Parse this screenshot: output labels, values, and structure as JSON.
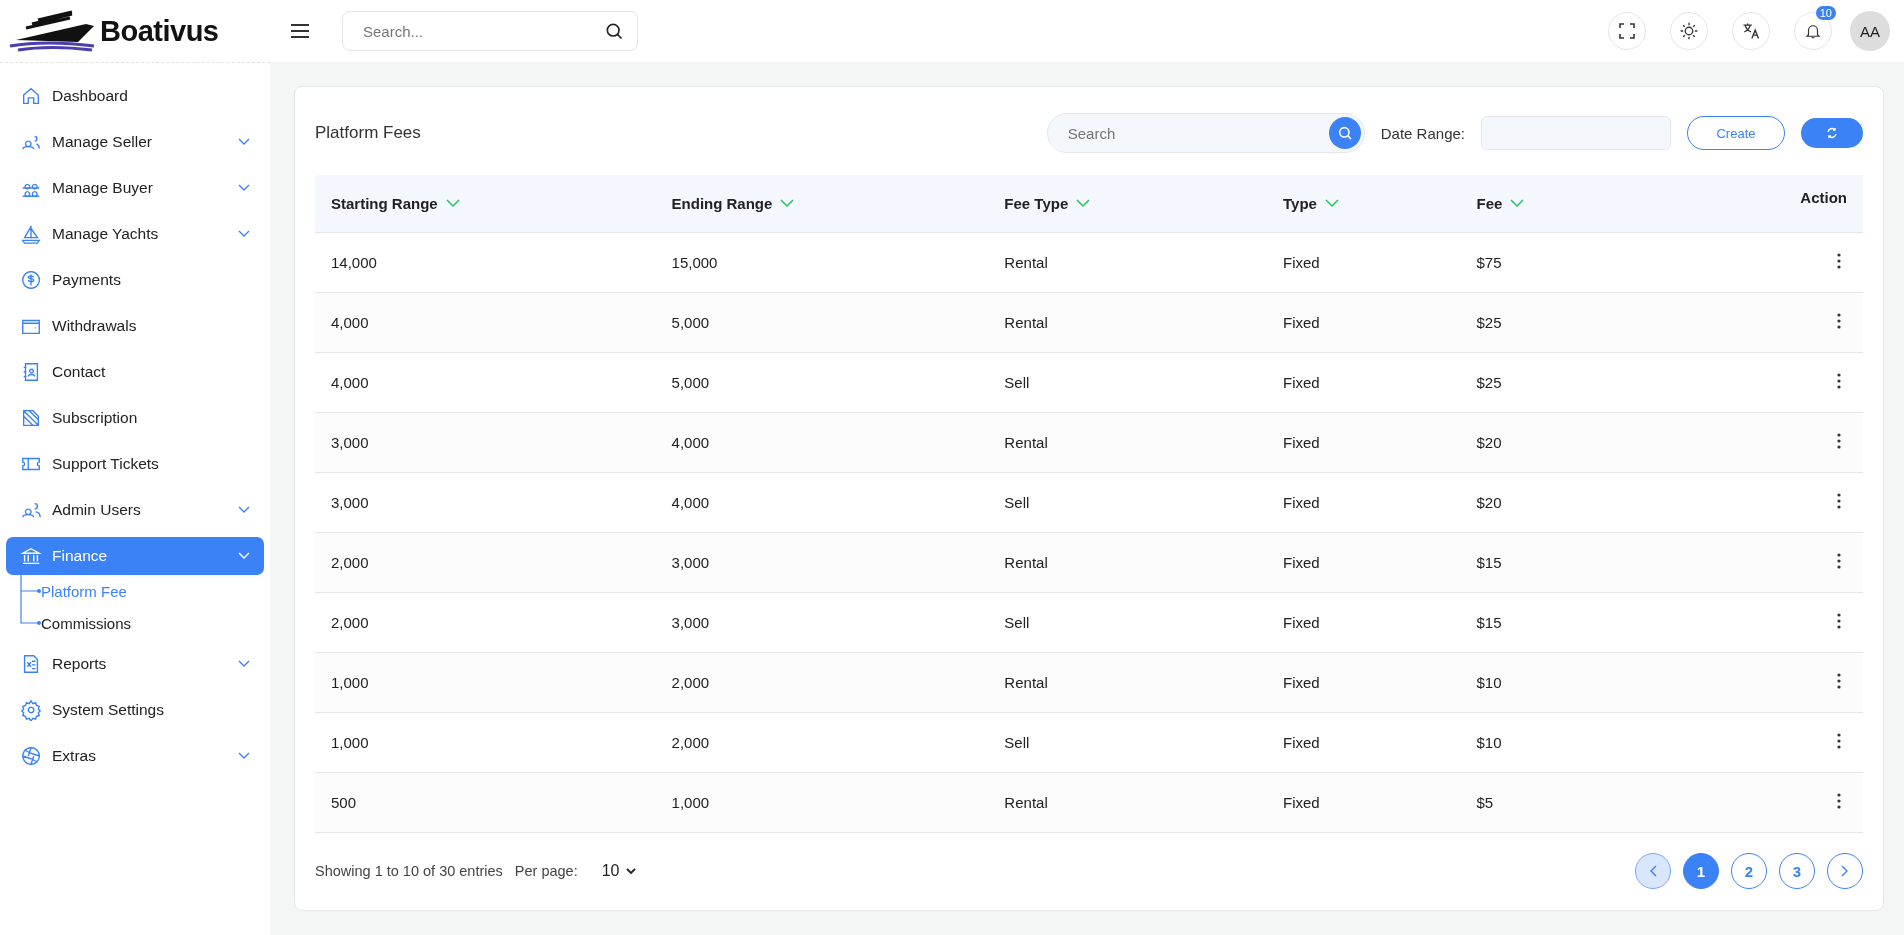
{
  "brand": {
    "name": "Boativus"
  },
  "topbar": {
    "search_placeholder": "Search...",
    "notification_count": "10",
    "avatar_initials": "AA"
  },
  "sidebar": {
    "items": [
      {
        "label": "Dashboard",
        "expandable": false,
        "selected": false
      },
      {
        "label": "Manage Seller",
        "expandable": true,
        "selected": false
      },
      {
        "label": "Manage Buyer",
        "expandable": true,
        "selected": false
      },
      {
        "label": "Manage Yachts",
        "expandable": true,
        "selected": false
      },
      {
        "label": "Payments",
        "expandable": false,
        "selected": false
      },
      {
        "label": "Withdrawals",
        "expandable": false,
        "selected": false
      },
      {
        "label": "Contact",
        "expandable": false,
        "selected": false
      },
      {
        "label": "Subscription",
        "expandable": false,
        "selected": false
      },
      {
        "label": "Support Tickets",
        "expandable": false,
        "selected": false
      },
      {
        "label": "Admin Users",
        "expandable": true,
        "selected": false
      },
      {
        "label": "Finance",
        "expandable": true,
        "selected": true,
        "children": [
          {
            "label": "Platform Fee",
            "selected": true
          },
          {
            "label": "Commissions",
            "selected": false
          }
        ]
      },
      {
        "label": "Reports",
        "expandable": true,
        "selected": false
      },
      {
        "label": "System Settings",
        "expandable": false,
        "selected": false
      },
      {
        "label": "Extras",
        "expandable": true,
        "selected": false
      }
    ]
  },
  "panel": {
    "title": "Platform Fees",
    "search_placeholder": "Search",
    "date_range_label": "Date Range:",
    "create_button": "Create"
  },
  "table": {
    "columns": [
      {
        "label": "Starting Range",
        "sortable": true
      },
      {
        "label": "Ending Range",
        "sortable": true
      },
      {
        "label": "Fee Type",
        "sortable": true
      },
      {
        "label": "Type",
        "sortable": true
      },
      {
        "label": "Fee",
        "sortable": true
      },
      {
        "label": "Action",
        "sortable": false
      }
    ],
    "rows": [
      [
        "14,000",
        "15,000",
        "Rental",
        "Fixed",
        "$75"
      ],
      [
        "4,000",
        "5,000",
        "Rental",
        "Fixed",
        "$25"
      ],
      [
        "4,000",
        "5,000",
        "Sell",
        "Fixed",
        "$25"
      ],
      [
        "3,000",
        "4,000",
        "Rental",
        "Fixed",
        "$20"
      ],
      [
        "3,000",
        "4,000",
        "Sell",
        "Fixed",
        "$20"
      ],
      [
        "2,000",
        "3,000",
        "Rental",
        "Fixed",
        "$15"
      ],
      [
        "2,000",
        "3,000",
        "Sell",
        "Fixed",
        "$15"
      ],
      [
        "1,000",
        "2,000",
        "Rental",
        "Fixed",
        "$10"
      ],
      [
        "1,000",
        "2,000",
        "Sell",
        "Fixed",
        "$10"
      ],
      [
        "500",
        "1,000",
        "Rental",
        "Fixed",
        "$5"
      ]
    ]
  },
  "footer": {
    "summary": "Showing 1 to 10 of 30 entries",
    "per_page_label": "Per page:",
    "per_page_value": "10"
  },
  "pagination": {
    "prev_disabled": true,
    "next_disabled": false,
    "pages": [
      {
        "label": "1",
        "selected": true
      },
      {
        "label": "2",
        "selected": false
      },
      {
        "label": "3",
        "selected": false
      }
    ]
  }
}
